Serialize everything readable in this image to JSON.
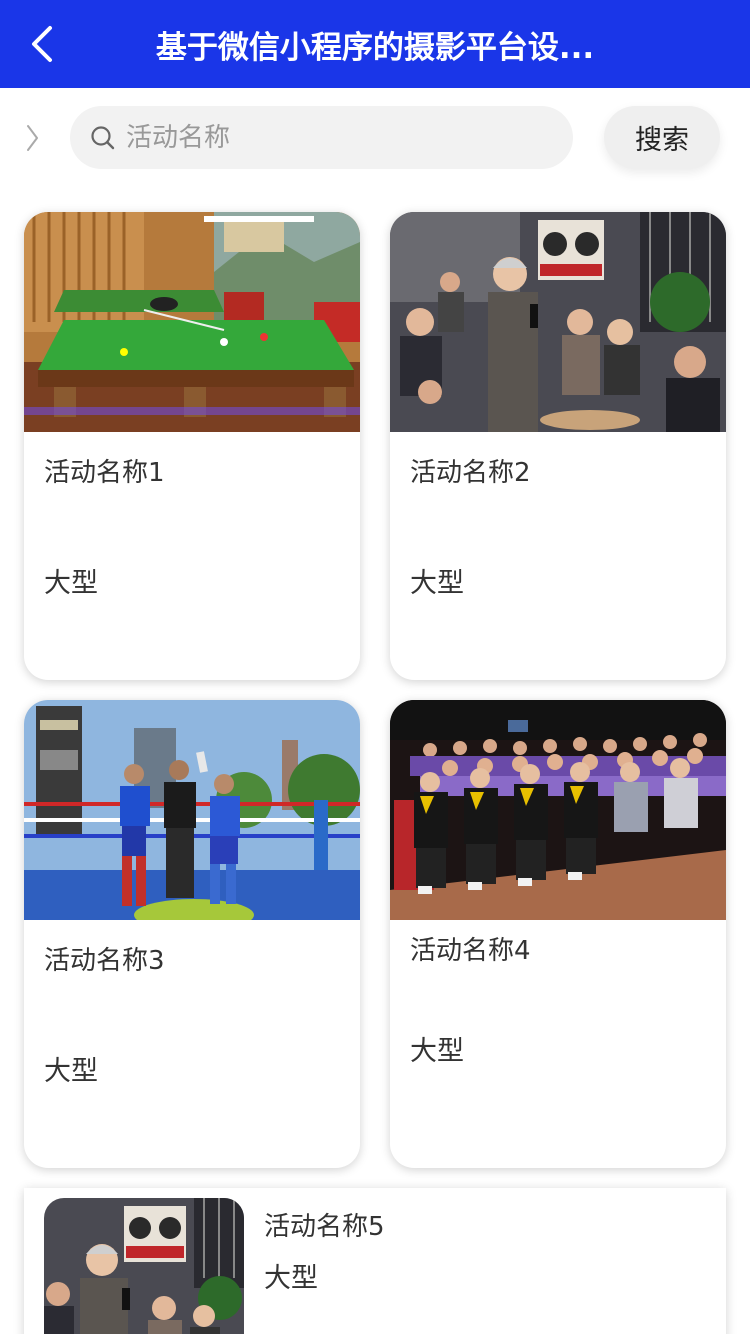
{
  "navbar": {
    "title": "基于微信小程序的摄影平台设...",
    "back_icon": "chevron-left-icon",
    "background": "#1a36e8"
  },
  "search": {
    "placeholder": "活动名称",
    "value": "",
    "button_label": "搜索",
    "icon": "search-icon",
    "side_icon": "chevron-right-icon"
  },
  "activities": [
    {
      "name": "活动名称1",
      "type": "大型",
      "image": "billiards-photo"
    },
    {
      "name": "活动名称2",
      "type": "大型",
      "image": "audience-speaker-photo"
    },
    {
      "name": "活动名称3",
      "type": "大型",
      "image": "boxing-ring-photo"
    },
    {
      "name": "活动名称4",
      "type": "大型",
      "image": "auditorium-crowd-photo"
    },
    {
      "name": "活动名称5",
      "type": "大型",
      "image": "audience-speaker-photo"
    }
  ]
}
